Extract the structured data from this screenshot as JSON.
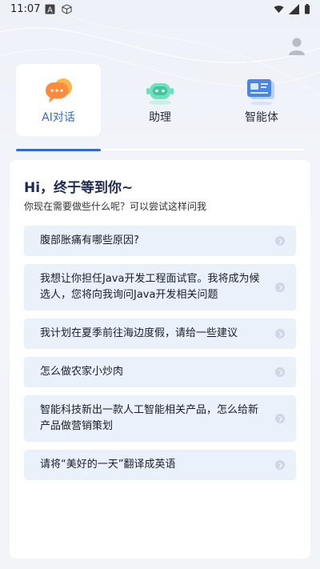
{
  "status_bar": {
    "time": "11:07",
    "left_icons": [
      "font-a-icon",
      "cube-icon"
    ],
    "right_icons": [
      "wifi-icon",
      "signal-icon",
      "battery-icon"
    ]
  },
  "header": {
    "profile_icon": "person-icon"
  },
  "tabs": [
    {
      "label": "AI对话",
      "icon": "chat-bubble-icon",
      "active": true
    },
    {
      "label": "助理",
      "icon": "robot-icon",
      "active": false
    },
    {
      "label": "智能体",
      "icon": "agent-card-icon",
      "active": false
    }
  ],
  "colors": {
    "accent": "#2f6bd8",
    "question_bg": "#ebf1fb",
    "greeting": "#1d2a55"
  },
  "main": {
    "greeting": "Hi，终于等到你~",
    "subtitle": "你现在需要做些什么呢？可以尝试这样问我",
    "questions": [
      "腹部胀痛有哪些原因?",
      "我想让你担任Java开发工程面试官。我将成为候选人，您将向我询问Java开发相关问题",
      "我计划在夏季前往海边度假，请给一些建议",
      "怎么做农家小炒肉",
      "智能科技新出一款人工智能相关产品，怎么给新产品做营销策划",
      "请将“美好的一天”翻译成英语"
    ]
  }
}
